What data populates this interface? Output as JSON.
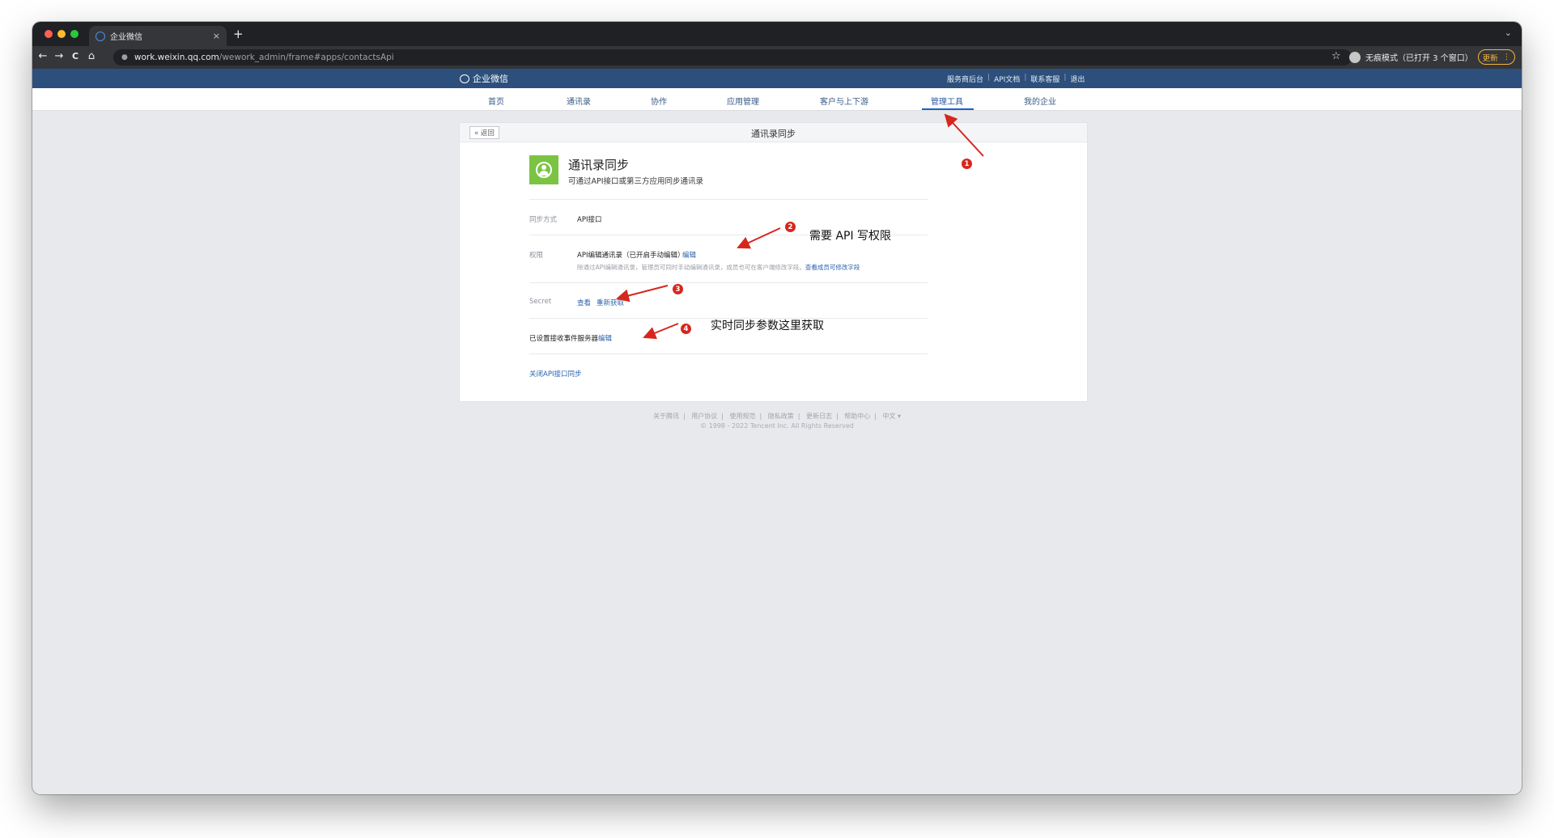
{
  "browser": {
    "tab_title": "企业微信",
    "url_host": "work.weixin.qq.com",
    "url_path": "/wework_admin/frame#apps/contactsApi",
    "incognito_label": "无痕模式（已打开 3 个窗口）",
    "update_label": "更新",
    "icons": {
      "back": "←",
      "forward": "→",
      "reload": "C",
      "home": "⌂",
      "lock": "🔒",
      "star": "☆",
      "close": "×",
      "newtab": "+",
      "menu": "⌄",
      "more": "⋮"
    }
  },
  "header": {
    "logo_text": "企业微信",
    "links": [
      "服务商后台",
      "API文档",
      "联系客服",
      "退出"
    ]
  },
  "nav": {
    "items": [
      "首页",
      "通讯录",
      "协作",
      "应用管理",
      "客户与上下游",
      "管理工具",
      "我的企业"
    ],
    "active": "管理工具"
  },
  "card": {
    "back_label": "« 返回",
    "title": "通讯录同步",
    "app_name": "通讯录同步",
    "app_desc": "可通过API接口或第三方应用同步通讯录",
    "sync_method_label": "同步方式",
    "sync_method_value": "API接口",
    "permission_label": "权限",
    "permission_value": "API编辑通讯录（已开启手动编辑）",
    "permission_edit": "编辑",
    "permission_hint": "除通过API编辑通讯录，管理员可同时手动编辑通讯录，成员也可在客户端修改字段。",
    "permission_hint_link": "查看成员可修改字段",
    "secret_label": "Secret",
    "secret_view": "查看",
    "secret_refresh": "重新获取",
    "event_server_label": "已设置接收事件服务器",
    "event_server_edit": "编辑",
    "close_sync": "关闭API接口同步"
  },
  "footer": {
    "links": [
      "关于腾讯",
      "用户协议",
      "使用规范",
      "隐私政策",
      "更新日志",
      "帮助中心",
      "中文 ▾"
    ],
    "copyright": "© 1998 - 2022 Tencent Inc. All Rights Reserved"
  },
  "annotations": {
    "badges": [
      "1",
      "2",
      "3",
      "4"
    ],
    "note_permission": "需要 API 写权限",
    "note_params": "实时同步参数这里获取",
    "color": "#d7261e"
  }
}
